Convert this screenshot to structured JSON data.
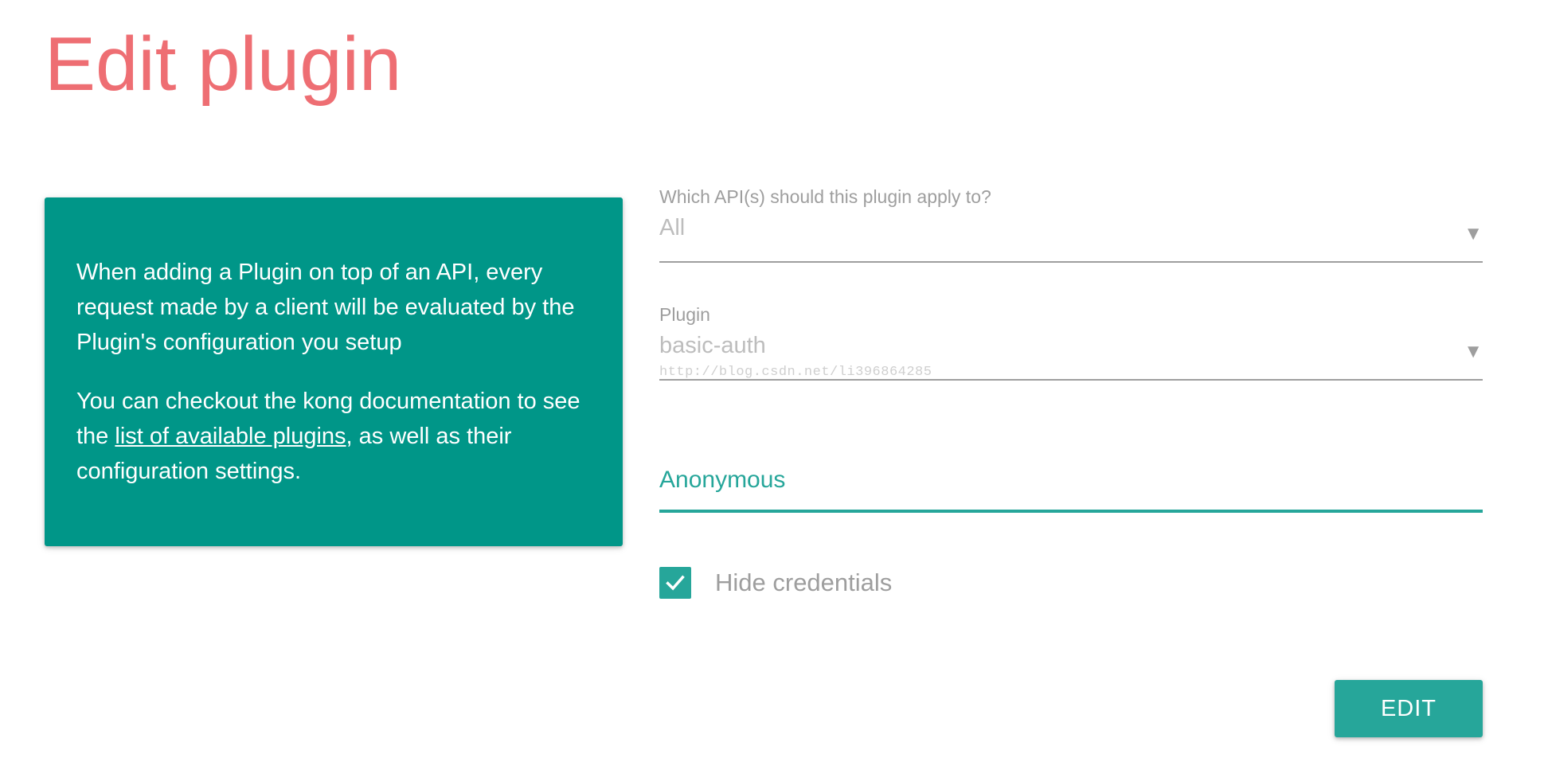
{
  "page": {
    "title": "Edit plugin"
  },
  "info_card": {
    "paragraph1": "When adding a Plugin on top of an API, every request made by a client will be evaluated by the Plugin's configuration you setup",
    "paragraph2_before": "You can checkout the kong documentation to see the ",
    "paragraph2_link": "list of available plugins",
    "paragraph2_after": ", as well as their configuration settings."
  },
  "form": {
    "api_select": {
      "label": "Which API(s) should this plugin apply to?",
      "value": "All",
      "caret_icon": "caret-down-icon"
    },
    "plugin_select": {
      "label": "Plugin",
      "value": "basic-auth",
      "caret_icon": "caret-down-icon"
    },
    "watermark": "http://blog.csdn.net/li396864285",
    "anonymous_field": {
      "label": "Anonymous",
      "value": ""
    },
    "hide_credentials": {
      "label": "Hide credentials",
      "checked": true
    },
    "submit_label": "EDIT"
  },
  "colors": {
    "title": "#ee6e73",
    "card": "#009688",
    "accent": "#26a69a",
    "muted_text": "#9e9e9e"
  }
}
